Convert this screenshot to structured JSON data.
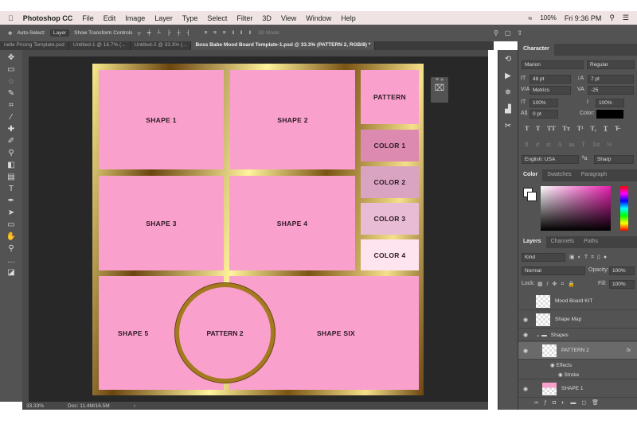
{
  "menubar": {
    "apple": "",
    "app": "Photoshop CC",
    "items": [
      "File",
      "Edit",
      "Image",
      "Layer",
      "Type",
      "Select",
      "Filter",
      "3D",
      "View",
      "Window",
      "Help"
    ],
    "battery": "100%",
    "clock": "Fri 9:36 PM"
  },
  "options": {
    "auto_select": "Auto-Select:",
    "auto_select_value": "Layer",
    "show_transform": "Show Transform Controls",
    "mode_3d": "3D Mode:"
  },
  "tabs": [
    "indle Pricing Template.psd",
    "Untitled-1 @ 16.7% (...",
    "Untitled-2 @ 33.3% (...",
    "Boss Babe Mood Board Template-1.psd @ 33.3% (PATTERN 2, RGB/8) *"
  ],
  "board": {
    "shape1": "SHAPE 1",
    "shape2": "SHAPE 2",
    "pattern": "PATTERN",
    "color1": "COLOR 1",
    "color2": "COLOR 2",
    "color3": "COLOR 3",
    "color4": "COLOR 4",
    "shape3": "SHAPE 3",
    "shape4": "SHAPE 4",
    "shape5": "SHAPE 5",
    "pattern2": "PATTERN 2",
    "shape6": "SHAPE SIX"
  },
  "board_colors": {
    "pink": "#f9a0cd",
    "color1": "#dc8ab0",
    "color2": "#d9a4c2",
    "color3": "#e8bcd4",
    "color4": "#fde4ef"
  },
  "status": {
    "zoom": "33.33%",
    "doc": "Doc: 11.4M/16.5M"
  },
  "character": {
    "title": "Character",
    "font": "Marion",
    "style": "Regular",
    "size": "48 pt",
    "leading": "7 pt",
    "kerning": "Metrics",
    "tracking": "-25",
    "vscale": "100%",
    "hscale": "100%",
    "baseline": "0 pt",
    "color_label": "Color:",
    "language": "English: USA",
    "aa": "Sharp"
  },
  "color_tabs": [
    "Color",
    "Swatches",
    "Paragraph"
  ],
  "layers": {
    "tabs": [
      "Layers",
      "Channels",
      "Paths"
    ],
    "kind": "Kind",
    "blend": "Normal",
    "opacity_label": "Opacity:",
    "opacity": "100%",
    "lock_label": "Lock:",
    "fill_label": "Fill:",
    "fill": "100%",
    "rows": [
      "Mood Board KIT",
      "Shape Map",
      "Shapes",
      "PATTERN 2",
      "Effects",
      "Stroke",
      "SHAPE 1"
    ],
    "fx": "fx"
  }
}
